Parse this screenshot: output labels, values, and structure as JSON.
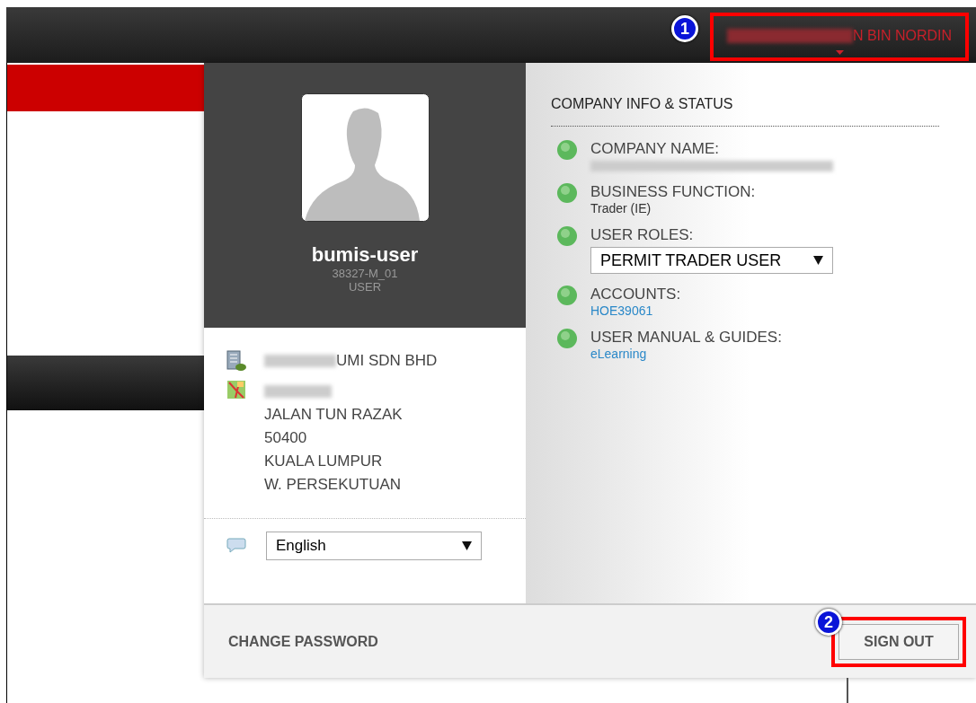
{
  "top_bar": {
    "user_name": "N BIN NORDIN",
    "callout": "1"
  },
  "profile": {
    "username": "bumis-user",
    "user_id": "38327-M_01",
    "role": "USER"
  },
  "address": {
    "company": "UMI SDN BHD",
    "lines": [
      "JALAN TUN RAZAK",
      "50400",
      "KUALA LUMPUR",
      "W. PERSEKUTUAN"
    ]
  },
  "language": {
    "value": "English"
  },
  "company_info": {
    "title": "COMPANY INFO & STATUS",
    "items": [
      {
        "label": "COMPANY NAME:",
        "kind": "redacted"
      },
      {
        "label": "BUSINESS FUNCTION:",
        "kind": "text",
        "value": "Trader (IE)"
      },
      {
        "label": "USER ROLES:",
        "kind": "select",
        "value": "PERMIT TRADER USER"
      },
      {
        "label": "ACCOUNTS:",
        "kind": "link",
        "value": "HOE39061"
      },
      {
        "label": "USER MANUAL & GUIDES:",
        "kind": "link",
        "value": "eLearning"
      }
    ]
  },
  "footer": {
    "change_password": "CHANGE PASSWORD",
    "sign_out": "SIGN OUT",
    "callout": "2"
  }
}
